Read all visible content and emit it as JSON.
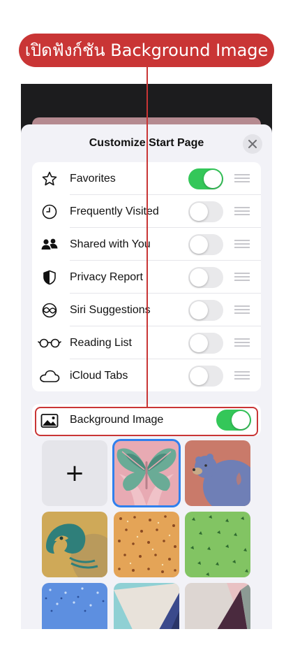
{
  "annotation": {
    "banner_text": "เปิดฟังก์ชัน Background Image",
    "color": "#c93535"
  },
  "sheet": {
    "title": "Customize Start Page",
    "close_icon": "close-icon"
  },
  "sections": [
    {
      "label": "Favorites",
      "icon": "star-icon",
      "enabled": true
    },
    {
      "label": "Frequently Visited",
      "icon": "clock-icon",
      "enabled": false
    },
    {
      "label": "Shared with You",
      "icon": "people-icon",
      "enabled": false
    },
    {
      "label": "Privacy Report",
      "icon": "shield-icon",
      "enabled": false
    },
    {
      "label": "Siri Suggestions",
      "icon": "siri-icon",
      "enabled": false
    },
    {
      "label": "Reading List",
      "icon": "glasses-icon",
      "enabled": false
    },
    {
      "label": "iCloud Tabs",
      "icon": "cloud-icon",
      "enabled": false
    }
  ],
  "background_image": {
    "label": "Background Image",
    "icon": "photo-icon",
    "enabled": true
  },
  "wallpapers": {
    "add_label": "+",
    "items": [
      {
        "name": "butterfly",
        "selected": true
      },
      {
        "name": "bear",
        "selected": false
      },
      {
        "name": "parrot",
        "selected": false
      },
      {
        "name": "orange-dots",
        "selected": false
      },
      {
        "name": "green-leaves",
        "selected": false
      },
      {
        "name": "blue-dots",
        "selected": false
      },
      {
        "name": "geometric-teal",
        "selected": false
      },
      {
        "name": "geometric-pink",
        "selected": false
      }
    ]
  },
  "colors": {
    "toggle_on": "#34c759",
    "toggle_off": "#e9e9eb",
    "selection": "#2f80ed"
  }
}
